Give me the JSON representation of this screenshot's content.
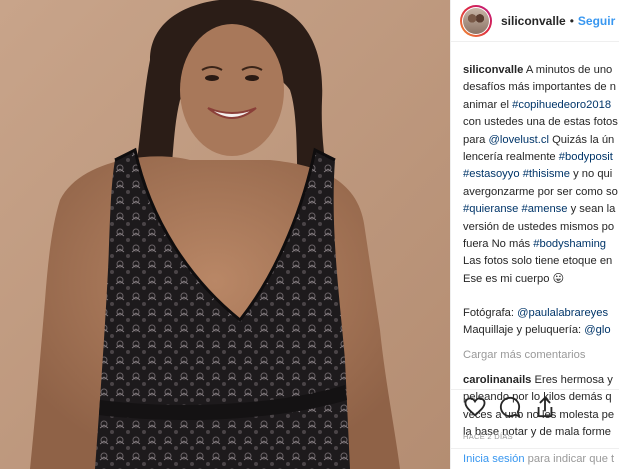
{
  "header": {
    "username": "siliconvalle",
    "separator": "•",
    "follow_label": "Seguir"
  },
  "caption_lines": [
    [
      {
        "t": "siliconvalle",
        "k": "b"
      },
      {
        "t": " A minutos de uno",
        "k": ""
      }
    ],
    [
      {
        "t": "desafíos más importantes de n",
        "k": ""
      }
    ],
    [
      {
        "t": "animar el ",
        "k": ""
      },
      {
        "t": "#copihuedeoro2018",
        "k": "tag"
      }
    ],
    [
      {
        "t": "con ustedes una de estas fotos",
        "k": ""
      }
    ],
    [
      {
        "t": "para ",
        "k": ""
      },
      {
        "t": "@lovelust.cl",
        "k": "tag"
      },
      {
        "t": " Quizás la ún",
        "k": ""
      }
    ],
    [
      {
        "t": "lencería realmente ",
        "k": ""
      },
      {
        "t": "#bodyposit",
        "k": "tag"
      }
    ],
    [
      {
        "t": "#estasoyyo",
        "k": "tag"
      },
      {
        "t": " ",
        "k": ""
      },
      {
        "t": "#thisisme",
        "k": "tag"
      },
      {
        "t": " y no qui",
        "k": ""
      }
    ],
    [
      {
        "t": "avergonzarme por ser como so",
        "k": ""
      }
    ],
    [
      {
        "t": "#quieranse",
        "k": "tag"
      },
      {
        "t": " ",
        "k": ""
      },
      {
        "t": "#amense",
        "k": "tag"
      },
      {
        "t": " y sean la",
        "k": ""
      }
    ],
    [
      {
        "t": "versión de ustedes mismos po",
        "k": ""
      }
    ],
    [
      {
        "t": "fuera No más ",
        "k": ""
      },
      {
        "t": "#bodyshaming",
        "k": "tag"
      }
    ],
    [
      {
        "t": "Las fotos solo tiene etoque en",
        "k": ""
      }
    ],
    [
      {
        "t": "Ese es mi cuerpo ",
        "k": ""
      },
      {
        "t": "😛",
        "k": ""
      }
    ]
  ],
  "credit_lines": [
    [
      {
        "t": "Fotógrafa: ",
        "k": ""
      },
      {
        "t": "@paulalabrareyes",
        "k": "tag"
      }
    ],
    [
      {
        "t": "Maquillaje y peluquería: ",
        "k": ""
      },
      {
        "t": "@glo",
        "k": "tag"
      }
    ]
  ],
  "load_more_label": "Cargar más comentarios",
  "comment_lines": [
    [
      {
        "t": "carolinanails",
        "k": "b"
      },
      {
        "t": " Eres hermosa y",
        "k": ""
      }
    ],
    [
      {
        "t": "peleando por lo kilos demás q",
        "k": ""
      }
    ],
    [
      {
        "t": "veces a uno no les molesta pe",
        "k": ""
      }
    ],
    [
      {
        "t": "la base notar y de mala forme",
        "k": ""
      }
    ]
  ],
  "actions": {
    "like_icon": "heart-icon",
    "comment_icon": "comment-icon",
    "share_icon": "share-icon"
  },
  "timestamp": "HACE 2 DÍAS",
  "login": {
    "link": "Inicia sesión",
    "rest": " para indicar que t"
  },
  "colors": {
    "link_blue": "#3897f0",
    "hashtag": "#003569",
    "muted": "#999999",
    "text": "#262626",
    "photo_bg": "#c09a80"
  }
}
